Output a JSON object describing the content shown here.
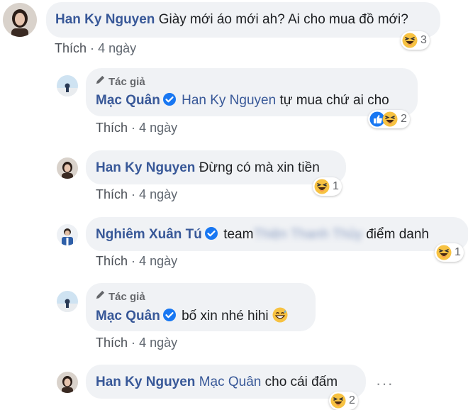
{
  "common": {
    "like_label": "Thích",
    "sep": "·",
    "author_badge": "Tác giả"
  },
  "comments": [
    {
      "name": "Han Ky Nguyen",
      "mention": "",
      "text": "Giày mới áo mới ah? Ai cho mua đồ mới?",
      "time": "4 ngày",
      "reactions": [
        "haha"
      ],
      "count": "3"
    },
    {
      "name": "Mạc Quân",
      "verified": true,
      "author": true,
      "mention": "Han Ky Nguyen",
      "text": "tự mua chứ ai cho",
      "time": "4 ngày",
      "reactions": [
        "like",
        "haha"
      ],
      "count": "2"
    },
    {
      "name": "Han Ky Nguyen",
      "mention": "",
      "text": "Đừng có mà xin tiền",
      "time": "4 ngày",
      "reactions": [
        "haha"
      ],
      "count": "1"
    },
    {
      "name": "Nghiêm Xuân Tú",
      "verified": true,
      "text_before": "team",
      "text_blurred": "Thiện Thanh Thủy",
      "text_after": "điểm danh",
      "time": "4 ngày",
      "reactions": [
        "haha"
      ],
      "count": "1"
    },
    {
      "name": "Mạc Quân",
      "verified": true,
      "author": true,
      "mention": "",
      "text": "bố xin nhé hihi",
      "time": "4 ngày",
      "emoji_inline": "grin-sweat"
    },
    {
      "name": "Han Ky Nguyen",
      "mention": "Mạc Quân",
      "text": "cho cái đấm",
      "reactions": [
        "haha"
      ],
      "count": "2",
      "more": "···"
    }
  ],
  "colors": {
    "name": "#385898",
    "bubble": "#f0f2f5",
    "meta": "#606770"
  }
}
